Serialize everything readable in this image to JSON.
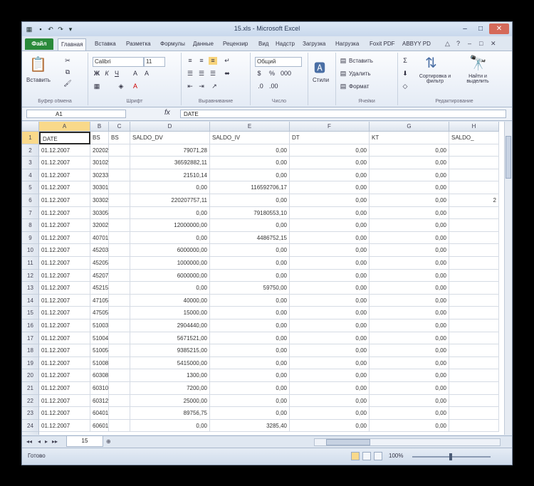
{
  "window": {
    "title": "15.xls - Microsoft Excel",
    "controls": {
      "minimize": "–",
      "maximize": "□",
      "close": "✕"
    }
  },
  "ribbon_tabs": [
    "Файл",
    "Главная",
    "Вставка",
    "Разметка",
    "Формулы",
    "Данные",
    "Рецензир",
    "Вид",
    "Надстр",
    "Загрузка",
    "Нагрузка",
    "Foxit PDF",
    "ABBYY PD"
  ],
  "ribbon": {
    "paste_label": "Вставить",
    "font_name": "Calibri",
    "font_size": "11",
    "number_format": "Общий",
    "styles_label": "Стили",
    "insert_label": "Вставить",
    "delete_label": "Удалить",
    "format_label": "Формат",
    "sort_label": "Сортировка и фильтр",
    "find_label": "Найти и выделить",
    "groups": {
      "clipboard": "Буфер обмена",
      "font": "Шрифт",
      "alignment": "Выравнивание",
      "number": "Число",
      "cells": "Ячейки",
      "editing": "Редактирование"
    }
  },
  "formula_bar": {
    "name_box": "A1",
    "fx": "fx",
    "formula": "DATE"
  },
  "columns": [
    "A",
    "B",
    "C",
    "D",
    "E",
    "F",
    "G",
    "H"
  ],
  "header_row": [
    "DATE",
    "BS",
    "BS",
    "SALDO_DV",
    "SALDO_IV",
    "DT",
    "KT",
    "SALDO_"
  ],
  "rows": [
    [
      "01.12.2007",
      "20202",
      "",
      "79071,28",
      "0,00",
      "0,00",
      "0,00",
      ""
    ],
    [
      "01.12.2007",
      "30102",
      "",
      "36592882,11",
      "0,00",
      "0,00",
      "0,00",
      ""
    ],
    [
      "01.12.2007",
      "30233",
      "",
      "21510,14",
      "0,00",
      "0,00",
      "0,00",
      ""
    ],
    [
      "01.12.2007",
      "30301",
      "",
      "0,00",
      "116592706,17",
      "0,00",
      "0,00",
      ""
    ],
    [
      "01.12.2007",
      "30302",
      "",
      "220207757,11",
      "0,00",
      "0,00",
      "0,00",
      "2"
    ],
    [
      "01.12.2007",
      "30305",
      "",
      "0,00",
      "79180553,10",
      "0,00",
      "0,00",
      ""
    ],
    [
      "01.12.2007",
      "32002",
      "",
      "12000000,00",
      "0,00",
      "0,00",
      "0,00",
      ""
    ],
    [
      "01.12.2007",
      "40701",
      "",
      "0,00",
      "4486752,15",
      "0,00",
      "0,00",
      ""
    ],
    [
      "01.12.2007",
      "45203",
      "",
      "6000000,00",
      "0,00",
      "0,00",
      "0,00",
      ""
    ],
    [
      "01.12.2007",
      "45205",
      "",
      "1000000,00",
      "0,00",
      "0,00",
      "0,00",
      ""
    ],
    [
      "01.12.2007",
      "45207",
      "",
      "6000000,00",
      "0,00",
      "0,00",
      "0,00",
      ""
    ],
    [
      "01.12.2007",
      "45215",
      "",
      "0,00",
      "59750,00",
      "0,00",
      "0,00",
      ""
    ],
    [
      "01.12.2007",
      "47105",
      "",
      "40000,00",
      "0,00",
      "0,00",
      "0,00",
      ""
    ],
    [
      "01.12.2007",
      "47505",
      "",
      "15000,00",
      "0,00",
      "0,00",
      "0,00",
      ""
    ],
    [
      "01.12.2007",
      "51003",
      "",
      "2904440,00",
      "0,00",
      "0,00",
      "0,00",
      ""
    ],
    [
      "01.12.2007",
      "51004",
      "",
      "5671521,00",
      "0,00",
      "0,00",
      "0,00",
      ""
    ],
    [
      "01.12.2007",
      "51005",
      "",
      "9385215,00",
      "0,00",
      "0,00",
      "0,00",
      ""
    ],
    [
      "01.12.2007",
      "51008",
      "",
      "5415000,00",
      "0,00",
      "0,00",
      "0,00",
      ""
    ],
    [
      "01.12.2007",
      "60308",
      "",
      "1300,00",
      "0,00",
      "0,00",
      "0,00",
      ""
    ],
    [
      "01.12.2007",
      "60310",
      "",
      "7200,00",
      "0,00",
      "0,00",
      "0,00",
      ""
    ],
    [
      "01.12.2007",
      "60312",
      "",
      "25000,00",
      "0,00",
      "0,00",
      "0,00",
      ""
    ],
    [
      "01.12.2007",
      "60401",
      "",
      "89756,75",
      "0,00",
      "0,00",
      "0,00",
      ""
    ],
    [
      "01.12.2007",
      "60601",
      "",
      "0,00",
      "3285,40",
      "0,00",
      "0,00",
      ""
    ]
  ],
  "row_numbers": [
    "1",
    "2",
    "3",
    "4",
    "5",
    "6",
    "7",
    "8",
    "9",
    "10",
    "11",
    "12",
    "13",
    "14",
    "15",
    "16",
    "17",
    "18",
    "19",
    "20",
    "21",
    "22",
    "23",
    "24"
  ],
  "sheet_tab": "15",
  "status": {
    "ready": "Готово",
    "zoom": "100%"
  }
}
